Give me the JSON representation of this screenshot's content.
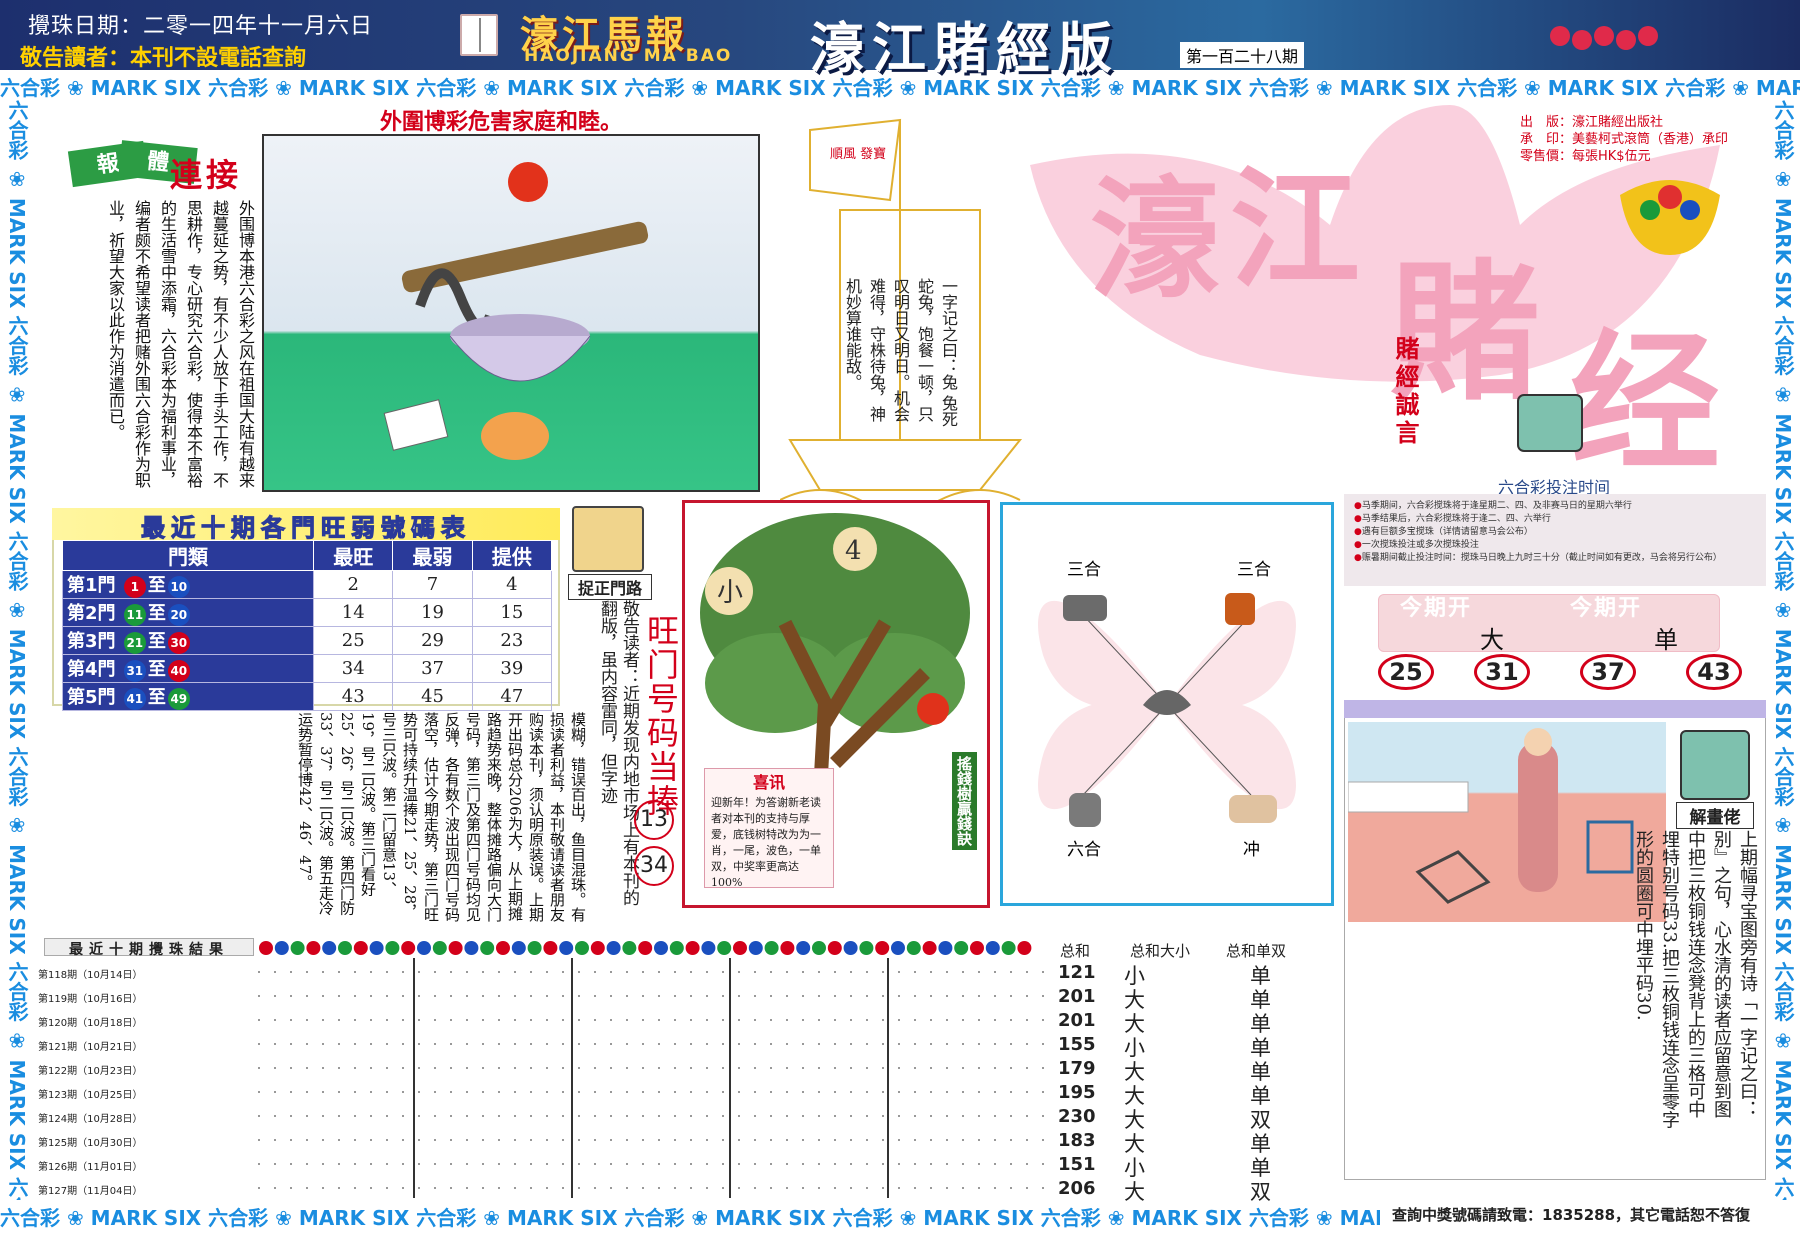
{
  "header": {
    "draw_date": "攪珠日期：二零一四年十一月六日",
    "notice": "敬告讀者：本刊不設電話查詢",
    "logo_cn": "濠江馬報",
    "logo_en": "HAOJIANG MA BAO",
    "edition_title": "濠江賭經版",
    "issue_no": "第一百二十八期"
  },
  "border_strip": {
    "text": "六合彩 ❀ MARK SIX 六合彩 ❀ MARK SIX 六合彩 ❀ MARK SIX 六合彩 ❀ MARK SIX 六合彩 ❀ MARK SIX 六合彩 ❀ MARK SIX 六合彩 ❀ MARK SIX 六合彩 ❀ MARK SIX 六合彩 ❀ MARK SIX 六合彩 ❀ MARK SIX"
  },
  "headline": "外圍博彩危害家庭和睦。",
  "comic": {
    "badge_a": "報",
    "badge_b": "體",
    "badge_c": "連接",
    "body": "外围博本港六合彩之风在祖国大陆有越来越蔓延之势，有不少人放下手头工作，不思耕作，专心研究六合彩，使得本不富裕的生活雪中添霜，六合彩本为福利事业，编者颇不希望读者把赌外围六合彩作为职业，祈望大家以此作为消遣而已。"
  },
  "boat": {
    "sail_text": "順風 發寶",
    "poem": "一字记之曰：兔 兔死蛇兔，饱餐一顿，只叹明日又明日。机会难得，守株待兔，神机妙算谁能敌。"
  },
  "title_art": {
    "chars": [
      "濠",
      "江",
      "賭",
      "经"
    ],
    "motto": "賭經誠言"
  },
  "publisher": {
    "line1": "出　版：濠江賭經出版社",
    "line2": "承　印：美藝柯式滾筒（香港）承印",
    "line3": "零售價：每張HK$伍元"
  },
  "gates_table": {
    "title": "最近十期各門旺弱號碼表",
    "headers": [
      "門類",
      "最旺",
      "最弱",
      "提供"
    ],
    "rows": [
      {
        "gate": "第1門",
        "from": "1",
        "to": "10",
        "hot": "2",
        "weak": "7",
        "tip": "4",
        "color_from": "red",
        "color_to": "blu"
      },
      {
        "gate": "第2門",
        "from": "11",
        "to": "20",
        "hot": "14",
        "weak": "19",
        "tip": "15",
        "color_from": "grn",
        "color_to": "blu"
      },
      {
        "gate": "第3門",
        "from": "21",
        "to": "30",
        "hot": "25",
        "weak": "29",
        "tip": "23",
        "color_from": "grn",
        "color_to": "red"
      },
      {
        "gate": "第4門",
        "from": "31",
        "to": "40",
        "hot": "34",
        "weak": "37",
        "tip": "39",
        "color_from": "blu",
        "color_to": "red"
      },
      {
        "gate": "第5門",
        "from": "41",
        "to": "49",
        "hot": "43",
        "weak": "45",
        "tip": "47",
        "color_from": "blu",
        "color_to": "grn"
      }
    ],
    "to_word": "至"
  },
  "zhuo_zheng": {
    "label": "捉正門路",
    "text": "敬告读者：近期发现内地市场上有本刊的翻版，虽内容雷同，但字迹"
  },
  "hot_numbers": {
    "title": "旺门号码当捧",
    "n1": "13",
    "n2": "34"
  },
  "long_text": "模糊，错误百出，鱼目混珠。有损读者利益，本刊敬请读者朋友购读本刊，须认明原装误。上期开出码总分206为大，从上期摊路趋势来晚，整体摊路偏向大门号码，第三门及第四门号码均见反弹，各有数个波出现四门号码落空，估计今期走势，第三门旺势可持续升温捧21、25、28，号三只波。第二门留意13、19，号二只波。第三门看好25、26，号二只波。第四门防33、37，号二只波。第五走冷运势暂停博42、46、47。",
  "tree": {
    "left_char": "小",
    "right_char": "4",
    "side_label": "搖錢樹贏錢訣",
    "xixun_title": "喜讯",
    "xixun_body": "迎新年！为答谢新老读者对本刊的支持与厚爱，底钱树特改为为一肖，一尾，波色，一单双，中奖率更高达100%"
  },
  "zodiac": {
    "tl": "三合",
    "tr": "三合",
    "bl": "六合",
    "br": "冲"
  },
  "bet_time": {
    "title": "六合彩投注时间",
    "lines": [
      "马季期间，六合彩搅珠将于逢星期二、四、及非赛马日的星期六举行",
      "马季结果后，六合彩搅珠将于逢二、四、六举行",
      "遇有巨额多宝搅珠（详情请留意马会公布）",
      "一次搅珠投注或多次搅珠投注",
      "赈暑期间截止投注时间：搅珠马日晚上九时三十分（截止时间如有更改，马会将另行公布）"
    ]
  },
  "this_period": {
    "label1": "今期开",
    "value1": "大",
    "label2": "今期开",
    "value2": "单",
    "numbers": [
      "25",
      "31",
      "37",
      "43"
    ]
  },
  "picture": {
    "label": "解畫佬",
    "text": "上期幅寻宝图旁有诗「一字记之曰：别』之句，心水清的读者应留意到图中把三枚铜钱连念凳背上的三格可中埋特别号码33.把三枚铜钱连念呈零字形的圆圈可中埋平码30."
  },
  "results": {
    "title": "最近十期攪珠結果",
    "sum_head": "总和",
    "size_head": "总和大小",
    "parity_head": "总和单双",
    "rows": [
      {
        "label": "第118期（10月14日）",
        "sum": "121",
        "size": "小",
        "parity": "单"
      },
      {
        "label": "第119期（10月16日）",
        "sum": "201",
        "size": "大",
        "parity": "单"
      },
      {
        "label": "第120期（10月18日）",
        "sum": "201",
        "size": "大",
        "parity": "单"
      },
      {
        "label": "第121期（10月21日）",
        "sum": "155",
        "size": "小",
        "parity": "单"
      },
      {
        "label": "第122期（10月23日）",
        "sum": "179",
        "size": "大",
        "parity": "单"
      },
      {
        "label": "第123期（10月25日）",
        "sum": "195",
        "size": "大",
        "parity": "单"
      },
      {
        "label": "第124期（10月28日）",
        "sum": "230",
        "size": "大",
        "parity": "双"
      },
      {
        "label": "第125期（10月30日）",
        "sum": "183",
        "size": "大",
        "parity": "单"
      },
      {
        "label": "第126期（11月01日）",
        "sum": "151",
        "size": "小",
        "parity": "单"
      },
      {
        "label": "第127期（11月04日）",
        "sum": "206",
        "size": "大",
        "parity": "双"
      }
    ]
  },
  "footer": {
    "tel": "查詢中獎號碼請致電：1835288，其它電話恕不答復"
  },
  "colors": {
    "brand_red": "#d3001a",
    "header_blue": "#1d2f6e",
    "accent_blue": "#1a8de0",
    "table_blue": "#2a3a9a"
  }
}
